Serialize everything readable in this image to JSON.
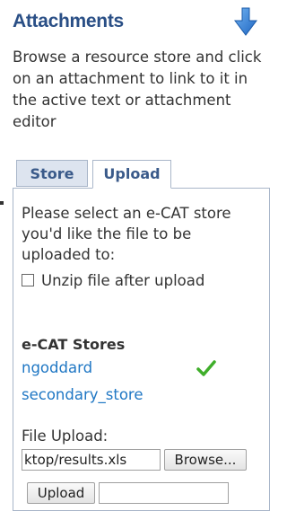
{
  "header": {
    "title": "Attachments",
    "action_icon": "down-arrow-icon"
  },
  "description": "Browse a resource store and click on an attachment to link to it in the active text or attachment editor",
  "tabs": [
    {
      "label": "Store",
      "active": false
    },
    {
      "label": "Upload",
      "active": true
    }
  ],
  "upload_panel": {
    "prompt": "Please select an e-CAT store you'd like the file to be uploaded to:",
    "unzip_label": "Unzip file after upload",
    "unzip_checked": false,
    "stores_heading": "e-CAT Stores",
    "stores": [
      {
        "name": "ngoddard",
        "selected": true,
        "selected_icon": "checkmark-icon"
      },
      {
        "name": "secondary_store",
        "selected": false
      }
    ],
    "file_upload_label": "File Upload:",
    "file_path": "ktop/results.xls",
    "browse_label": "Browse...",
    "upload_label": "Upload",
    "upload_field_value": ""
  },
  "colors": {
    "title": "#2a4f86",
    "tab_text": "#3a5a8a",
    "inactive_tab_bg": "#dde4ef",
    "border": "#a9b6c9",
    "link": "#1f77c4",
    "check": "#3fae2a",
    "arrow": "#2f7fd6"
  }
}
